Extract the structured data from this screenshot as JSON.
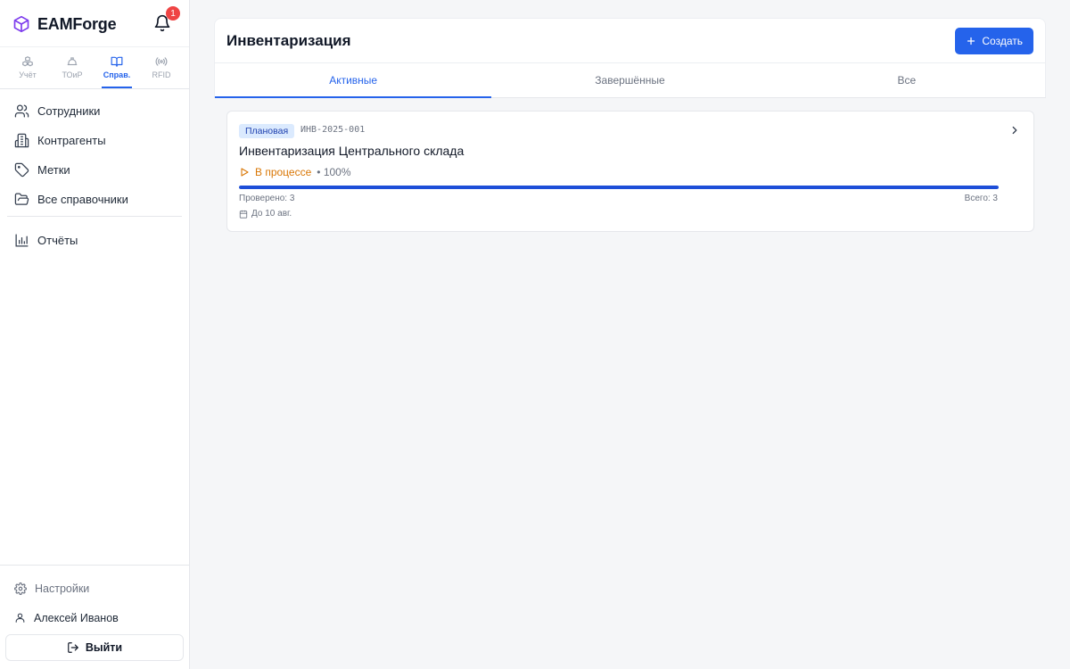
{
  "app": {
    "name": "EAMForge",
    "notifications_count": "1"
  },
  "mode_tabs": [
    {
      "label": "Учёт",
      "icon": "cubes-icon"
    },
    {
      "label": "ТОиР",
      "icon": "helmet-icon"
    },
    {
      "label": "Справ.",
      "icon": "book-icon",
      "active": true
    },
    {
      "label": "RFID",
      "icon": "rfid-icon"
    }
  ],
  "nav": {
    "items": [
      {
        "label": "Сотрудники",
        "icon": "users-icon"
      },
      {
        "label": "Контрагенты",
        "icon": "building-icon"
      },
      {
        "label": "Метки",
        "icon": "tag-icon"
      },
      {
        "label": "Все справочники",
        "icon": "folder-icon"
      },
      {
        "label": "Отчёты",
        "icon": "bar-chart-icon"
      }
    ]
  },
  "bottom": {
    "settings_label": "Настройки",
    "user_name": "Алексей Иванов",
    "logout_label": "Выйти"
  },
  "page": {
    "title": "Инвентаризация",
    "create_label": "Создать",
    "tabs": [
      {
        "label": "Активные",
        "active": true
      },
      {
        "label": "Завершённые"
      },
      {
        "label": "Все"
      }
    ]
  },
  "card": {
    "type": "Плановая",
    "code": "ИНВ-2025-001",
    "title": "Инвентаризация Центрального склада",
    "status": "В процессе",
    "percent_text": "• 100%",
    "progress_percent": 100,
    "checked": "Проверено: 3",
    "total": "Всего: 3",
    "due": "До 10 авг."
  },
  "colors": {
    "accent": "#2563eb",
    "brand": "#7c3aed",
    "status": "#d97706",
    "badge": "#ef4444"
  }
}
